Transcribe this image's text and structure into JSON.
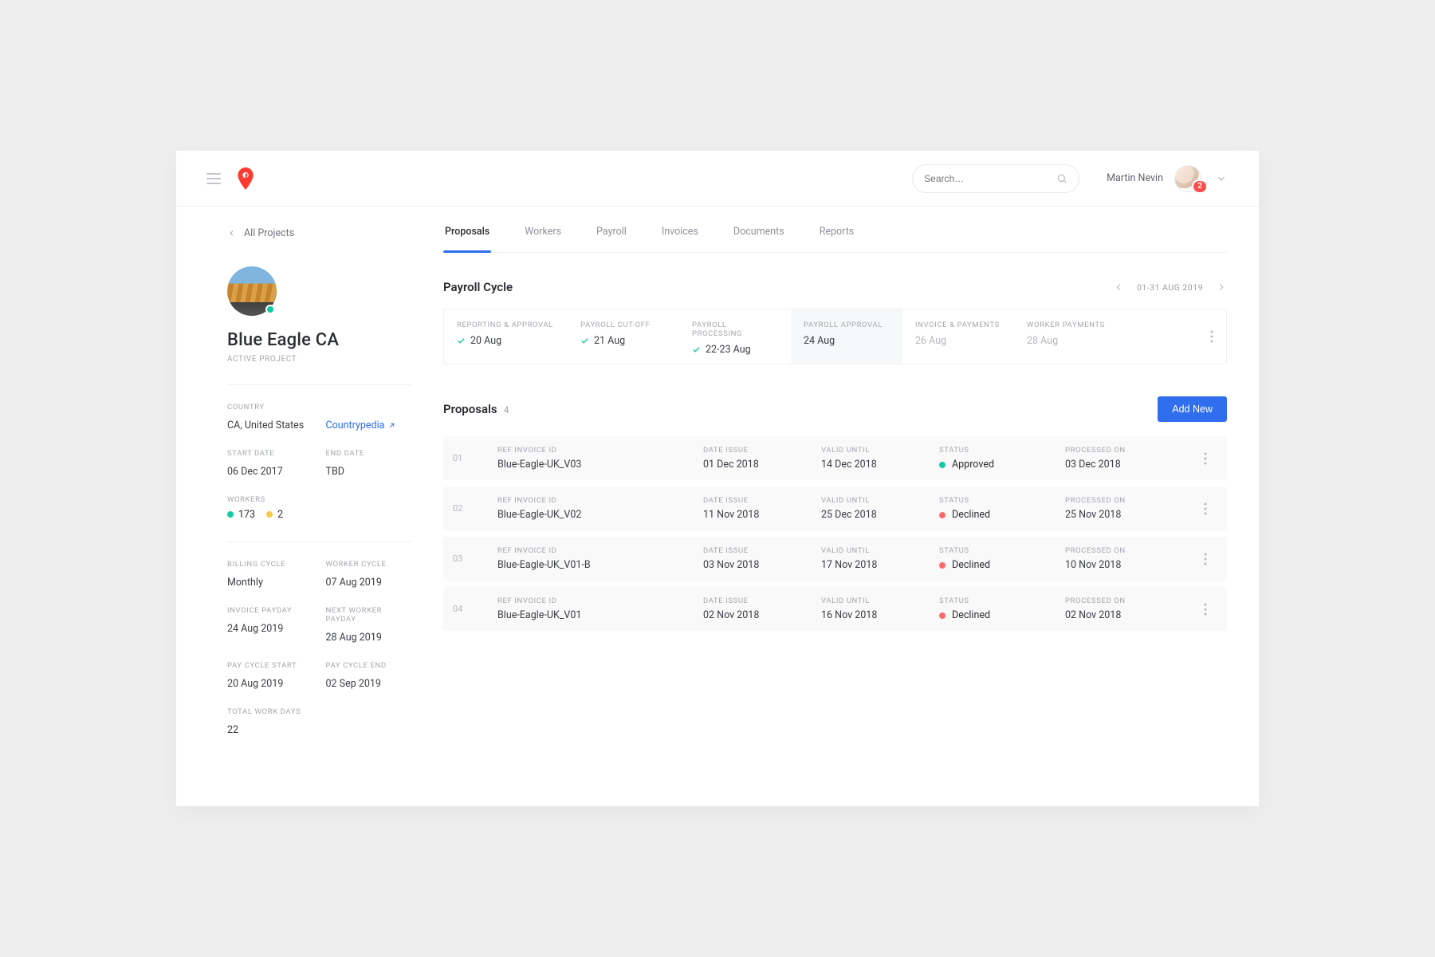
{
  "header": {
    "search_placeholder": "Search…",
    "user_name": "Martin Nevin",
    "badge": "2"
  },
  "breadcrumb": {
    "label": "All Projects"
  },
  "project": {
    "title": "Blue Eagle CA",
    "subtitle": "ACTIVE PROJECT",
    "country_label": "COUNTRY",
    "country_value": "CA, United States",
    "country_link": "Countrypedia",
    "start_label": "START DATE",
    "start_value": "06 Dec 2017",
    "end_label": "END DATE",
    "end_value": "TBD",
    "workers_label": "WORKERS",
    "workers_active": "173",
    "workers_pending": "2",
    "billing_cycle_label": "BILLING CYCLE",
    "billing_cycle_value": "Monthly",
    "worker_cycle_label": "WORKER CYCLE",
    "worker_cycle_value": "07 Aug 2019",
    "invoice_payday_label": "INVOICE PAYDAY",
    "invoice_payday_value": "24 Aug 2019",
    "next_worker_payday_label": "NEXT WORKER PAYDAY",
    "next_worker_payday_value": "28 Aug 2019",
    "pay_cycle_start_label": "PAY CYCLE START",
    "pay_cycle_start_value": "20 Aug 2019",
    "pay_cycle_end_label": "PAY CYCLE END",
    "pay_cycle_end_value": "02 Sep 2019",
    "total_work_days_label": "TOTAL WORK DAYS",
    "total_work_days_value": "22"
  },
  "tabs": [
    "Proposals",
    "Workers",
    "Payroll",
    "Invoices",
    "Documents",
    "Reports"
  ],
  "payroll_cycle": {
    "title": "Payroll Cycle",
    "range": "01-31 AUG 2019",
    "steps": [
      {
        "label": "REPORTING & APPROVAL",
        "date": "20 Aug",
        "done": true
      },
      {
        "label": "PAYROLL CUT-OFF",
        "date": "21 Aug",
        "done": true
      },
      {
        "label": "PAYROLL PROCESSING",
        "date": "22-23 Aug",
        "done": true
      },
      {
        "label": "PAYROLL APPROVAL",
        "date": "24 Aug",
        "active": true
      },
      {
        "label": "INVOICE & PAYMENTS",
        "date": "26 Aug",
        "muted": true
      },
      {
        "label": "WORKER PAYMENTS",
        "date": "28 Aug",
        "muted": true
      }
    ]
  },
  "proposals": {
    "title": "Proposals",
    "count": "4",
    "add_label": "Add New",
    "col_labels": {
      "ref": "REF INVOICE ID",
      "date_issue": "DATE ISSUE",
      "valid_until": "VALID UNTIL",
      "status": "STATUS",
      "processed_on": "PROCESSED ON"
    },
    "rows": [
      {
        "num": "01",
        "ref": "Blue-Eagle-UK_V03",
        "date_issue": "01 Dec 2018",
        "valid_until": "14 Dec 2018",
        "status": "Approved",
        "status_color": "green2",
        "processed_on": "03 Dec 2018"
      },
      {
        "num": "02",
        "ref": "Blue-Eagle-UK_V02",
        "date_issue": "11 Nov 2018",
        "valid_until": "25 Dec 2018",
        "status": "Declined",
        "status_color": "red",
        "processed_on": "25 Nov 2018"
      },
      {
        "num": "03",
        "ref": "Blue-Eagle-UK_V01-B",
        "date_issue": "03 Nov 2018",
        "valid_until": "17 Nov 2018",
        "status": "Declined",
        "status_color": "red",
        "processed_on": "10 Nov 2018"
      },
      {
        "num": "04",
        "ref": "Blue-Eagle-UK_V01",
        "date_issue": "02 Nov 2018",
        "valid_until": "16 Nov 2018",
        "status": "Declined",
        "status_color": "red",
        "processed_on": "02 Nov 2018"
      }
    ]
  }
}
